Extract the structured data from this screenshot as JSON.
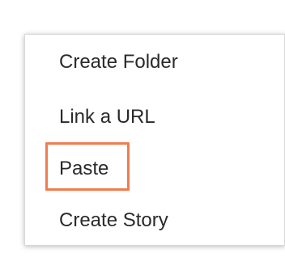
{
  "menu": {
    "items": [
      {
        "label": "Create Folder"
      },
      {
        "label": "Link a URL"
      },
      {
        "label": "Paste"
      },
      {
        "label": "Create Story"
      }
    ]
  },
  "colors": {
    "highlight": "#ef7d4f",
    "text": "#2a2a2a",
    "background": "#ffffff"
  }
}
